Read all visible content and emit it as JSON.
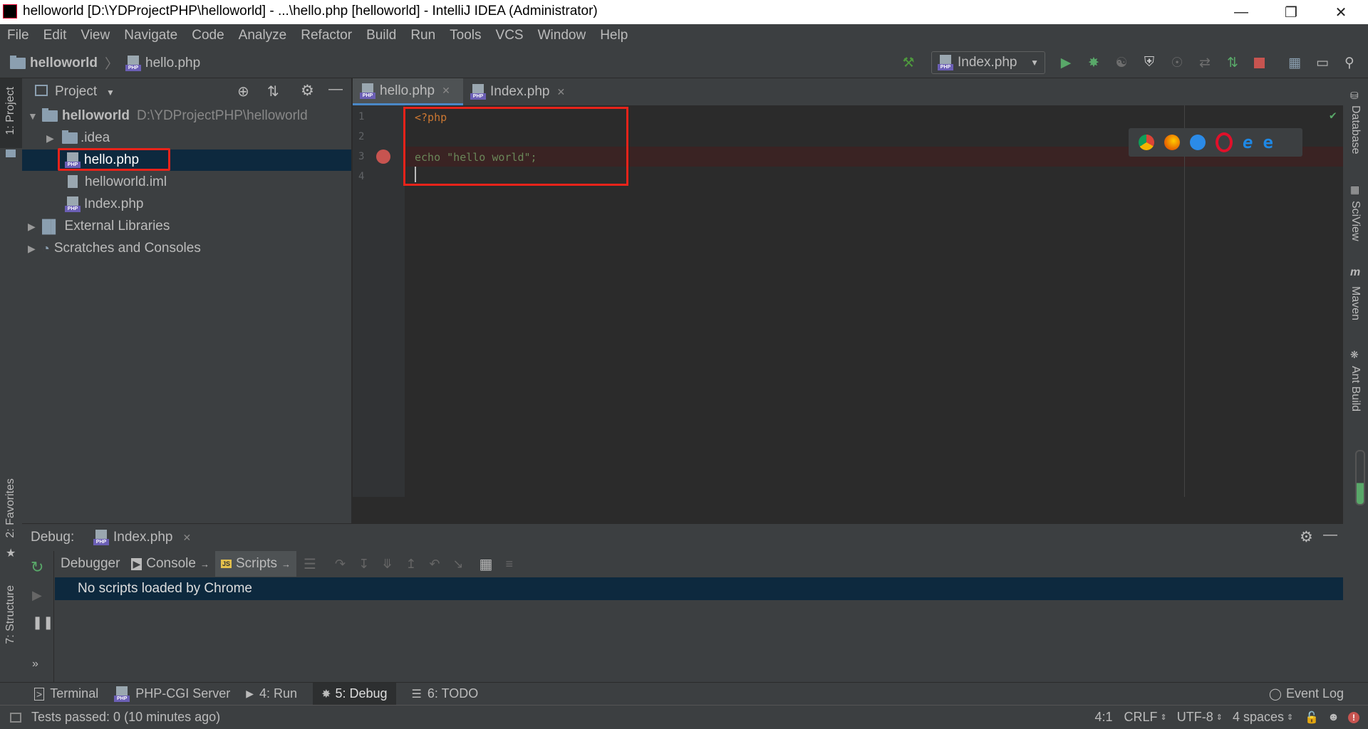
{
  "window": {
    "title": "helloworld [D:\\YDProjectPHP\\helloworld] - ...\\hello.php [helloworld] - IntelliJ IDEA (Administrator)"
  },
  "menu": [
    "File",
    "Edit",
    "View",
    "Navigate",
    "Code",
    "Analyze",
    "Refactor",
    "Build",
    "Run",
    "Tools",
    "VCS",
    "Window",
    "Help"
  ],
  "breadcrumb": {
    "project": "helloworld",
    "file": "hello.php"
  },
  "run_config": "Index.php",
  "left_stripe": {
    "project": "1: Project",
    "favorites": "2: Favorites",
    "structure": "7: Structure"
  },
  "project_panel": {
    "title": "Project",
    "root_name": "helloworld",
    "root_path": "D:\\YDProjectPHP\\helloworld",
    "items": [
      {
        "label": ".idea"
      },
      {
        "label": "hello.php"
      },
      {
        "label": "helloworld.iml"
      },
      {
        "label": "Index.php"
      },
      {
        "label": "External Libraries"
      },
      {
        "label": "Scratches and Consoles"
      }
    ]
  },
  "editor": {
    "tabs": [
      {
        "label": "hello.php"
      },
      {
        "label": "Index.php"
      }
    ],
    "line_numbers": [
      "1",
      "2",
      "3",
      "4"
    ],
    "lines": [
      "<?php",
      "",
      "echo \"hello world\";",
      ""
    ]
  },
  "right_stripe": [
    "Database",
    "SciView",
    "Maven",
    "Ant Build"
  ],
  "debug": {
    "label": "Debug:",
    "session_tab": "Index.php",
    "tabs": [
      "Debugger",
      "Console",
      "Scripts"
    ],
    "message": "No scripts loaded by Chrome"
  },
  "tool_tabs": [
    "Terminal",
    "PHP-CGI Server",
    "4: Run",
    "5: Debug",
    "6: TODO"
  ],
  "event_log": "Event Log",
  "status": {
    "message": "Tests passed: 0 (10 minutes ago)",
    "position": "4:1",
    "line_sep": "CRLF",
    "encoding": "UTF-8",
    "indent": "4 spaces"
  },
  "colors": {
    "accent": "#4a88c7",
    "highlight_box": "#e8231a",
    "breakpoint": "#c75450",
    "selection": "#0d293e"
  }
}
